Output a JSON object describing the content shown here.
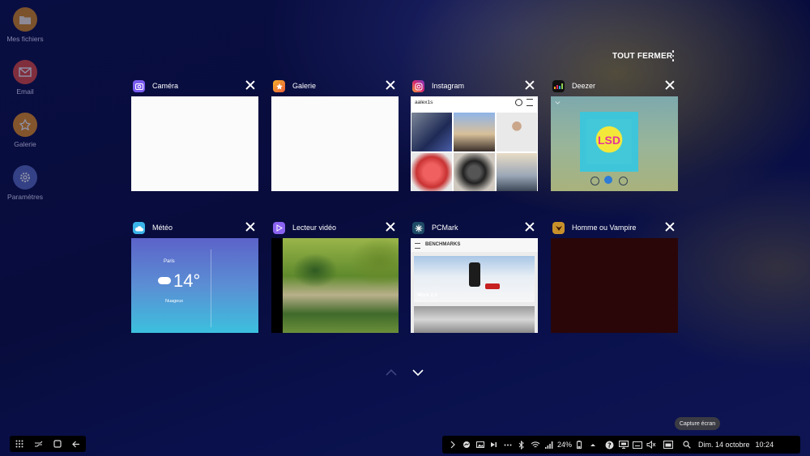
{
  "desktop": [
    {
      "label": "Mes fichiers",
      "icon": "folder-icon",
      "color": "#d98a1c"
    },
    {
      "label": "Email",
      "icon": "email-icon",
      "color": "#e24a3b"
    },
    {
      "label": "Galerie",
      "icon": "gallery-icon",
      "color": "#e8901c"
    },
    {
      "label": "Paramètres",
      "icon": "settings-icon",
      "color": "#5a6cc0"
    }
  ],
  "recents": {
    "close_all": "TOUT FERMER",
    "cards": [
      {
        "title": "Caméra",
        "icon": "camera-icon",
        "color": "#7a5cf0"
      },
      {
        "title": "Galerie",
        "icon": "gallery-icon",
        "color": "#f08a2a"
      },
      {
        "title": "Instagram",
        "icon": "instagram-icon",
        "color": "#c13584",
        "account": "aalex1s"
      },
      {
        "title": "Deezer",
        "icon": "deezer-icon",
        "color": "#111111",
        "album_text": "LSD"
      },
      {
        "title": "Météo",
        "icon": "weather-icon",
        "color": "#3ab3e8",
        "city": "Paris",
        "temp": "14°",
        "condition": "Nuageux"
      },
      {
        "title": "Lecteur vidéo",
        "icon": "video-player-icon",
        "color": "#8a62f0"
      },
      {
        "title": "PCMark",
        "icon": "pcmark-icon",
        "color": "#1e4a66",
        "header": "BENCHMARKS",
        "test": "Work 2.0"
      },
      {
        "title": "Homme ou Vampire",
        "icon": "vampire-game-icon",
        "color": "#c8902a"
      }
    ]
  },
  "taskbar": {
    "battery": "24%",
    "date": "Dim. 14 octobre",
    "time": "10:24",
    "tooltip": "Capture écran"
  },
  "colors": {
    "accent": "#ffffff",
    "taskbar": "#000000"
  }
}
